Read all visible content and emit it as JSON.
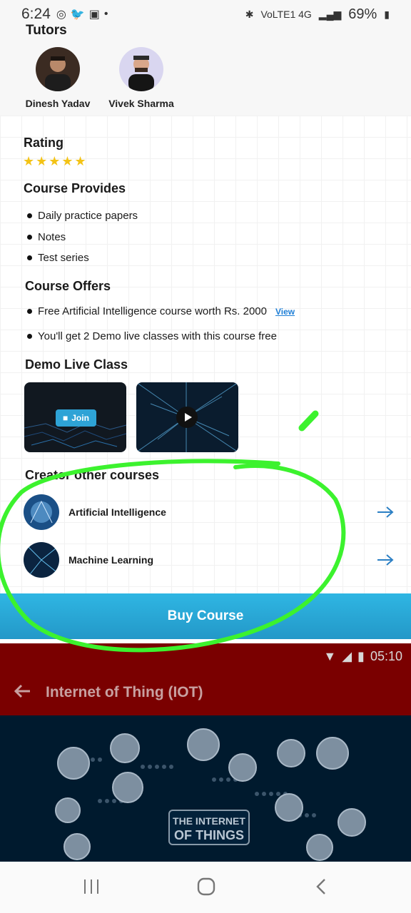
{
  "status_bar": {
    "time": "6:24",
    "app_icons": [
      "messenger-icon",
      "twitter-icon",
      "gallery-icon"
    ],
    "network": "VoLTE1 4G",
    "battery": "69%"
  },
  "tutors": {
    "title": "Tutors",
    "items": [
      {
        "name": "Dinesh Yadav"
      },
      {
        "name": "Vivek Sharma"
      }
    ]
  },
  "rating": {
    "title": "Rating",
    "stars": "★★★★★"
  },
  "course_provides": {
    "title": "Course Provides",
    "items": [
      "Daily practice papers",
      "Notes",
      "Test series"
    ]
  },
  "course_offers": {
    "title": "Course Offers",
    "items": [
      {
        "text": "Free Artificial Intelligence course worth Rs. 2000",
        "link": "View"
      },
      {
        "text": "You'll get 2 Demo live classes with this course free"
      }
    ]
  },
  "demo_live_class": {
    "title": "Demo Live Class",
    "join_label": "Join"
  },
  "creator_courses": {
    "title": "Creator other courses",
    "items": [
      {
        "label": "Artificial Intelligence"
      },
      {
        "label": "Machine Learning"
      }
    ]
  },
  "buy_button": "Buy Course",
  "second_app": {
    "time": "05:10",
    "title": "Internet of Thing (IOT)",
    "banner_line1": "THE INTERNET",
    "banner_line2": "OF THINGS"
  },
  "colors": {
    "accent": "#2ea3d6",
    "star": "#f3c316",
    "highlight": "#3cf22e",
    "app2_bar": "#7a0000"
  }
}
